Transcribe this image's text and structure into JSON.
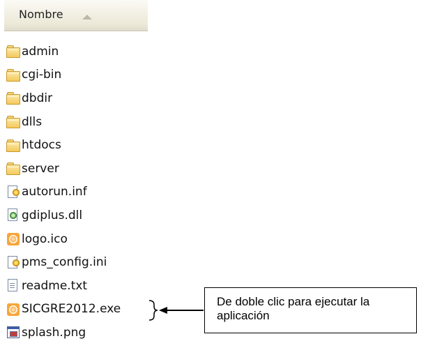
{
  "column_header": {
    "label": "Nombre",
    "sort_icon": "sort-ascending-icon"
  },
  "files": [
    {
      "name": "admin",
      "icon": "folder-icon"
    },
    {
      "name": "cgi-bin",
      "icon": "folder-icon"
    },
    {
      "name": "dbdir",
      "icon": "folder-icon"
    },
    {
      "name": "dlls",
      "icon": "folder-icon"
    },
    {
      "name": "htdocs",
      "icon": "folder-icon"
    },
    {
      "name": "server",
      "icon": "folder-icon"
    },
    {
      "name": "autorun.inf",
      "icon": "config-file-icon"
    },
    {
      "name": "gdiplus.dll",
      "icon": "dll-file-icon"
    },
    {
      "name": "logo.ico",
      "icon": "ico-file-icon"
    },
    {
      "name": "pms_config.ini",
      "icon": "config-file-icon"
    },
    {
      "name": "readme.txt",
      "icon": "text-file-icon"
    },
    {
      "name": "SICGRE2012.exe",
      "icon": "exe-file-icon"
    },
    {
      "name": "splash.png",
      "icon": "image-file-icon"
    }
  ],
  "callout": {
    "line1": "De doble clic para ejecutar la",
    "line2": "aplicación"
  },
  "colors": {
    "header_bg": "#ece9d8",
    "folder": "#f3c95c",
    "icon_orange": "#f7a63a"
  }
}
